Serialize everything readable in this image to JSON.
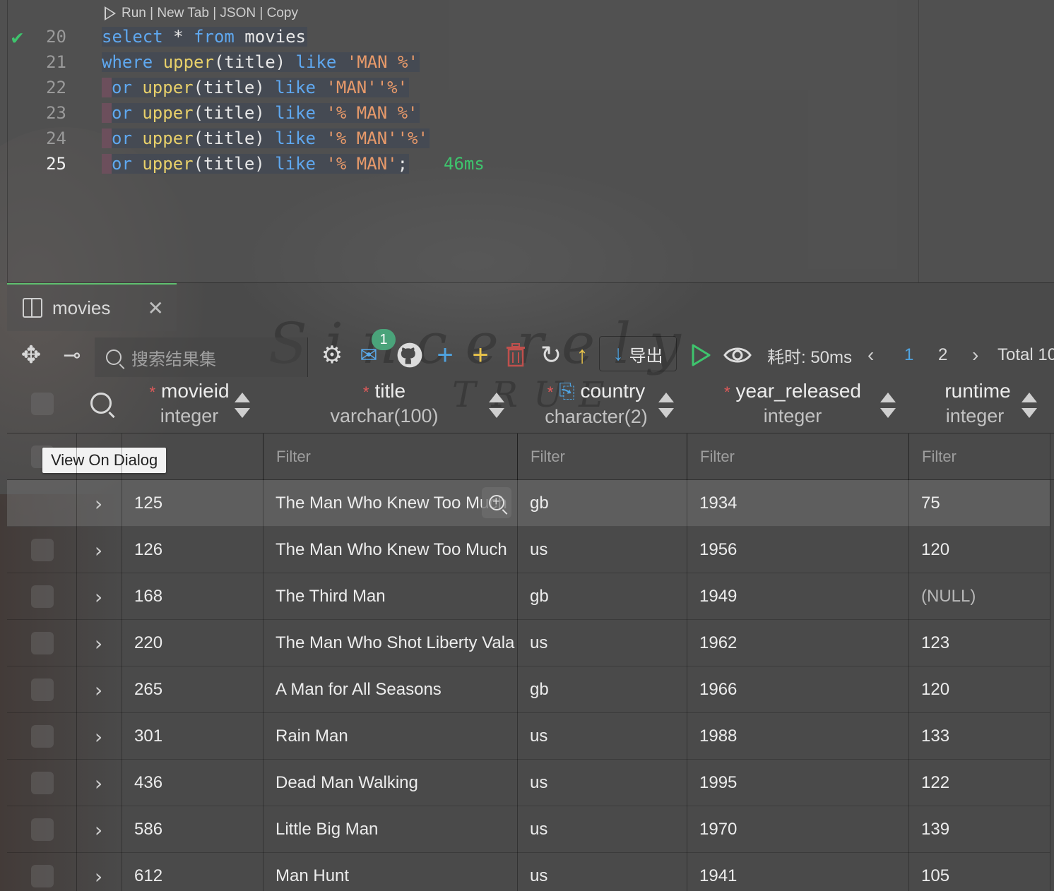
{
  "editor": {
    "codelens": "Run | New Tab | JSON | Copy",
    "lines": [
      {
        "num": "20",
        "tokens": [
          [
            "kw",
            "select"
          ],
          [
            "pl",
            " * "
          ],
          [
            "kw",
            "from"
          ],
          [
            "pl",
            " movies"
          ]
        ]
      },
      {
        "num": "21",
        "tokens": [
          [
            "kw",
            "where"
          ],
          [
            "pl",
            " "
          ],
          [
            "fn",
            "upper"
          ],
          [
            "pl",
            "(title) "
          ],
          [
            "kw",
            "like"
          ],
          [
            "pl",
            " "
          ],
          [
            "str",
            "'MAN %'"
          ]
        ]
      },
      {
        "num": "22",
        "tokens": [
          [
            "kw",
            "or"
          ],
          [
            "pl",
            " "
          ],
          [
            "fn",
            "upper"
          ],
          [
            "pl",
            "(title) "
          ],
          [
            "kw",
            "like"
          ],
          [
            "pl",
            " "
          ],
          [
            "str",
            "'MAN''%'"
          ]
        ]
      },
      {
        "num": "23",
        "tokens": [
          [
            "kw",
            "or"
          ],
          [
            "pl",
            " "
          ],
          [
            "fn",
            "upper"
          ],
          [
            "pl",
            "(title) "
          ],
          [
            "kw",
            "like"
          ],
          [
            "pl",
            " "
          ],
          [
            "str",
            "'% MAN %'"
          ]
        ]
      },
      {
        "num": "24",
        "tokens": [
          [
            "kw",
            "or"
          ],
          [
            "pl",
            " "
          ],
          [
            "fn",
            "upper"
          ],
          [
            "pl",
            "(title) "
          ],
          [
            "kw",
            "like"
          ],
          [
            "pl",
            " "
          ],
          [
            "str",
            "'% MAN''%'"
          ]
        ]
      },
      {
        "num": "25",
        "tokens": [
          [
            "kw",
            "or"
          ],
          [
            "pl",
            " "
          ],
          [
            "fn",
            "upper"
          ],
          [
            "pl",
            "(title) "
          ],
          [
            "kw",
            "like"
          ],
          [
            "pl",
            " "
          ],
          [
            "str",
            "'% MAN'"
          ],
          [
            "pl",
            ";"
          ]
        ]
      }
    ],
    "exec_time": "46ms"
  },
  "result_tab": {
    "label": "movies"
  },
  "toolbar": {
    "search_placeholder": "搜索结果集",
    "badge_count": "1",
    "export_label": "导出",
    "elapsed": "耗时: 50ms",
    "pages": [
      "1",
      "2"
    ],
    "current_page": "1",
    "total": "Total 10"
  },
  "columns": [
    {
      "name": "movieid",
      "type": "integer",
      "required": "*"
    },
    {
      "name": "title",
      "type": "varchar(100)",
      "required": "*"
    },
    {
      "name": "country",
      "type": "character(2)",
      "required": "*"
    },
    {
      "name": "year_released",
      "type": "integer",
      "required": "*"
    },
    {
      "name": "runtime",
      "type": "integer",
      "required": ""
    }
  ],
  "filter_placeholder": "Filter",
  "tooltip": "View On Dialog",
  "rows": [
    [
      "125",
      "The Man Who Knew Too Much",
      "gb",
      "1934",
      "75"
    ],
    [
      "126",
      "The Man Who Knew Too Much",
      "us",
      "1956",
      "120"
    ],
    [
      "168",
      "The Third Man",
      "gb",
      "1949",
      "(NULL)"
    ],
    [
      "220",
      "The Man Who Shot Liberty Valance",
      "us",
      "1962",
      "123"
    ],
    [
      "265",
      "A Man for All Seasons",
      "gb",
      "1966",
      "120"
    ],
    [
      "301",
      "Rain Man",
      "us",
      "1988",
      "133"
    ],
    [
      "436",
      "Dead Man Walking",
      "us",
      "1995",
      "122"
    ],
    [
      "586",
      "Little Big Man",
      "us",
      "1970",
      "139"
    ],
    [
      "612",
      "Man Hunt",
      "us",
      "1941",
      "105"
    ]
  ],
  "colors": {
    "keyword": "#5fa8f0",
    "function": "#e8d06a",
    "string": "#e89a6a",
    "success": "#3ec46d",
    "accent_blue": "#4fa3e0",
    "accent_yellow": "#e8c34a"
  }
}
